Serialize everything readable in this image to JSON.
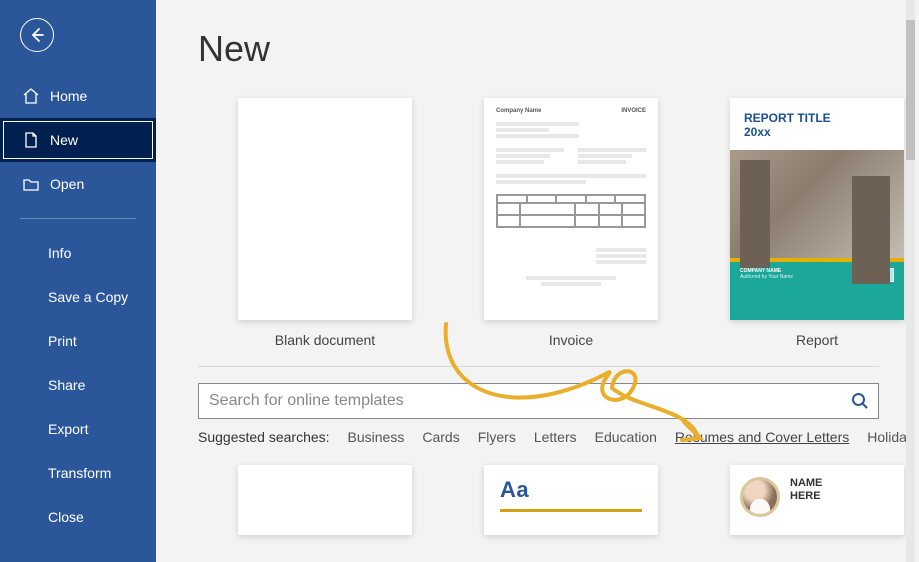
{
  "page_title": "New",
  "sidebar": {
    "nav": [
      {
        "label": "Home",
        "icon": "home-icon"
      },
      {
        "label": "New",
        "icon": "document-icon"
      },
      {
        "label": "Open",
        "icon": "folder-icon"
      }
    ],
    "sub_items": [
      "Info",
      "Save a Copy",
      "Print",
      "Share",
      "Export",
      "Transform",
      "Close"
    ]
  },
  "templates": {
    "row1": [
      {
        "label": "Blank document"
      },
      {
        "label": "Invoice",
        "preview": {
          "company": "Company Name",
          "invoice_word": "INVOICE"
        }
      },
      {
        "label": "Report",
        "preview": {
          "title_line1": "REPORT TITLE",
          "title_line2": "20xx",
          "company": "COMPANY NAME",
          "sub": "Authored by Your Name",
          "logo": "Logo"
        }
      }
    ],
    "row2": [
      {
        "type": "blank"
      },
      {
        "type": "aa",
        "text": "Aa"
      },
      {
        "type": "resume",
        "name_line1": "NAME",
        "name_line2": "HERE"
      }
    ]
  },
  "search": {
    "placeholder": "Search for online templates"
  },
  "suggested": {
    "label": "Suggested searches:",
    "items": [
      "Business",
      "Cards",
      "Flyers",
      "Letters",
      "Education",
      "Resumes and Cover Letters",
      "Holiday"
    ],
    "highlighted_index": 5
  }
}
